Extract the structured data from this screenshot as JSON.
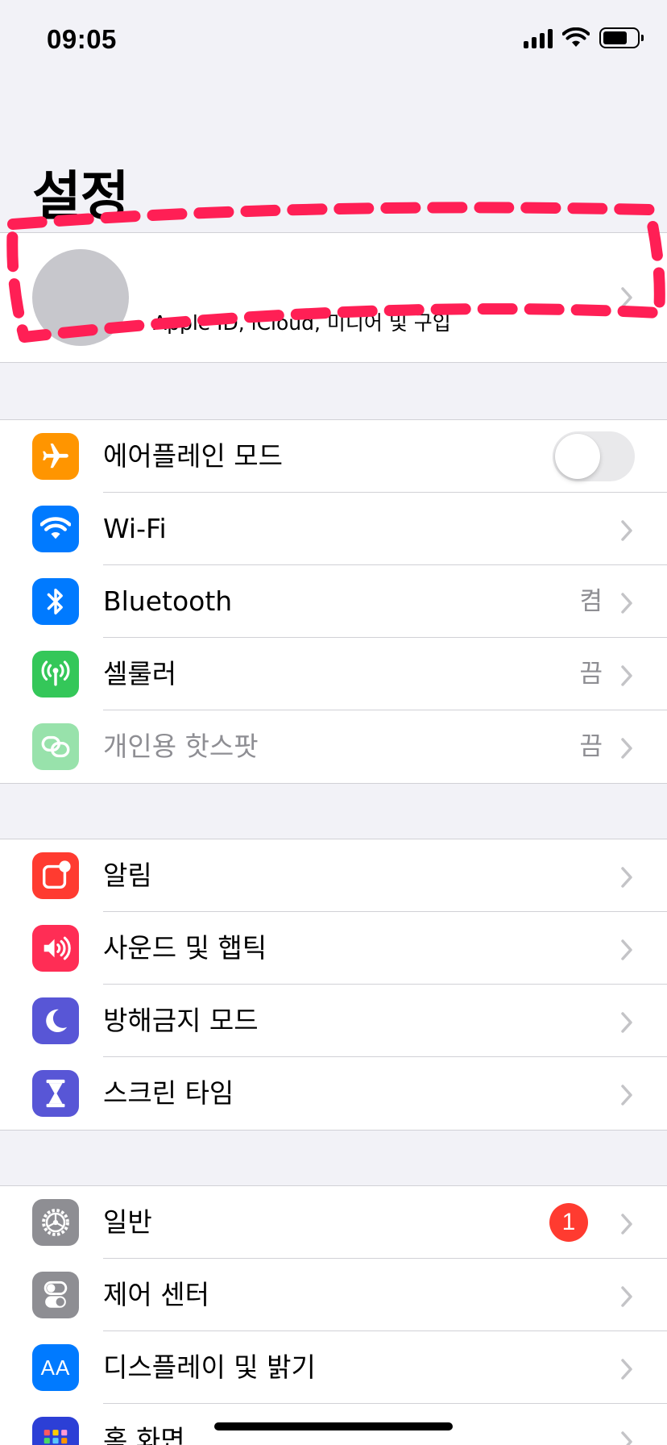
{
  "status_bar": {
    "time": "09:05",
    "icons": [
      "cellular-signal-icon",
      "wifi-icon",
      "battery-icon"
    ],
    "battery_level": 0.72
  },
  "page": {
    "title": "설정"
  },
  "profile": {
    "subtitle": "Apple ID, iCloud, 미디어 및 구입",
    "highlight_color": "#ff1f55"
  },
  "group1": {
    "items": [
      {
        "label": "에어플레인 모드",
        "icon": "airplane-icon",
        "color": "#ff9500",
        "control": "toggle",
        "toggle_on": false
      },
      {
        "label": "Wi-Fi",
        "icon": "wifi-icon",
        "color": "#007aff",
        "value": ""
      },
      {
        "label": "Bluetooth",
        "icon": "bluetooth-icon",
        "color": "#007aff",
        "value": "켬"
      },
      {
        "label": "셀룰러",
        "icon": "antenna-icon",
        "color": "#34c759",
        "value": "끔"
      },
      {
        "label": "개인용 핫스팟",
        "icon": "hotspot-link-icon",
        "color": "#34c759",
        "value": "끔",
        "disabled": true
      }
    ]
  },
  "group2": {
    "items": [
      {
        "label": "알림",
        "icon": "notifications-icon",
        "color": "#ff3b30"
      },
      {
        "label": "사운드 및 햅틱",
        "icon": "speaker-icon",
        "color": "#ff2d55"
      },
      {
        "label": "방해금지 모드",
        "icon": "moon-icon",
        "color": "#5856d6"
      },
      {
        "label": "스크린 타임",
        "icon": "hourglass-icon",
        "color": "#5856d6"
      }
    ]
  },
  "group3": {
    "items": [
      {
        "label": "일반",
        "icon": "gear-icon",
        "color": "#8e8e93",
        "badge": "1"
      },
      {
        "label": "제어 센터",
        "icon": "switches-icon",
        "color": "#8e8e93"
      },
      {
        "label": "디스플레이 및 밝기",
        "icon": "text-size-icon",
        "color": "#007aff",
        "icon_text": "AA"
      },
      {
        "label": "홈 화면",
        "icon": "home-grid-icon",
        "color": "#2c3fd6"
      }
    ]
  }
}
